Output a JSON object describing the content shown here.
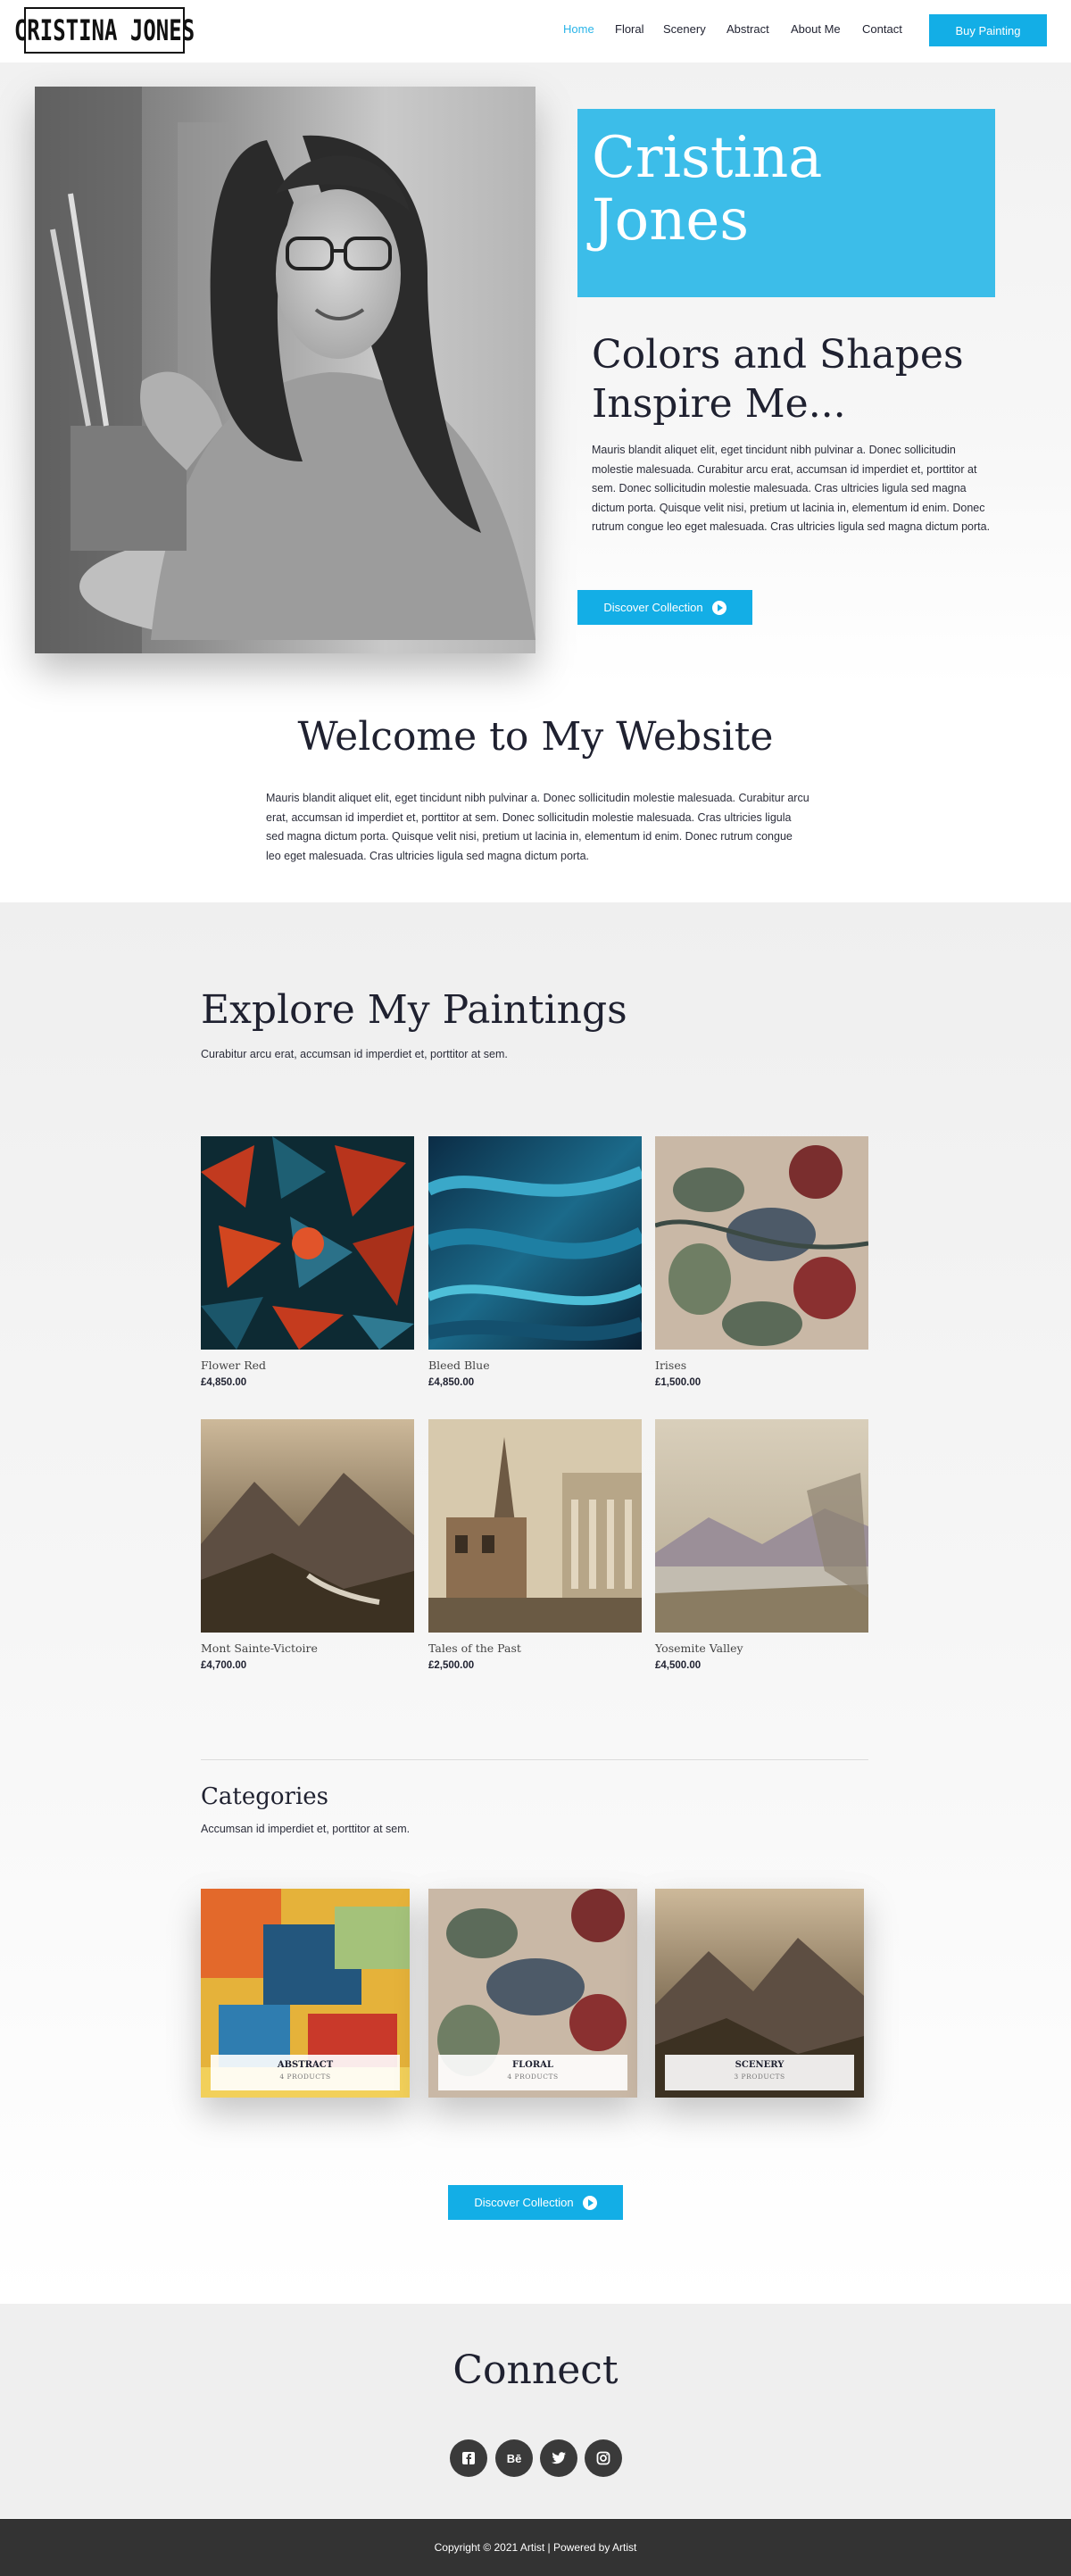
{
  "header": {
    "logo": "CRISTINA JONES",
    "nav": [
      {
        "label": "Home",
        "active": true
      },
      {
        "label": "Floral",
        "active": false
      },
      {
        "label": "Scenery",
        "active": false
      },
      {
        "label": "Abstract",
        "active": false
      },
      {
        "label": "About Me",
        "active": false
      },
      {
        "label": "Contact",
        "active": false
      }
    ],
    "cta": "Buy Painting"
  },
  "hero": {
    "name": "Cristina Jones",
    "heading": "Colors and Shapes Inspire Me...",
    "text": "Mauris blandit aliquet elit, eget tincidunt nibh pulvinar a. Donec sollicitudin molestie malesuada. Curabitur arcu erat, accumsan id imperdiet et, porttitor at sem. Donec sollicitudin molestie malesuada. Cras ultricies ligula sed magna dictum porta. Quisque velit nisi, pretium ut lacinia in, elementum id enim. Donec rutrum congue leo eget malesuada. Cras ultricies ligula sed magna dictum porta.",
    "button": "Discover Collection"
  },
  "welcome": {
    "title": "Welcome to My Website",
    "text": "Mauris blandit aliquet elit, eget tincidunt nibh pulvinar a. Donec sollicitudin molestie malesuada. Curabitur arcu erat, accumsan id imperdiet et, porttitor at sem. Donec sollicitudin molestie malesuada. Cras ultricies ligula sed magna dictum porta. Quisque velit nisi, pretium ut lacinia in, elementum id enim. Donec rutrum congue leo eget malesuada. Cras ultricies ligula sed magna dictum porta."
  },
  "explore": {
    "title": "Explore My Paintings",
    "subtitle": "Curabitur arcu erat, accumsan id imperdiet et, porttitor at sem.",
    "products": [
      {
        "name": "Flower Red",
        "price": "£4,850.00"
      },
      {
        "name": "Bleed Blue",
        "price": "£4,850.00"
      },
      {
        "name": "Irises",
        "price": "£1,500.00"
      },
      {
        "name": "Mont Sainte-Victoire",
        "price": "£4,700.00"
      },
      {
        "name": "Tales of the Past",
        "price": "£2,500.00"
      },
      {
        "name": "Yosemite Valley",
        "price": "£4,500.00"
      }
    ]
  },
  "categories": {
    "title": "Categories",
    "subtitle": "Accumsan id imperdiet et, porttitor at sem.",
    "items": [
      {
        "name": "ABSTRACT",
        "count": "4 PRODUCTS"
      },
      {
        "name": "FLORAL",
        "count": "4 PRODUCTS"
      },
      {
        "name": "SCENERY",
        "count": "3 PRODUCTS"
      }
    ],
    "button": "Discover Collection"
  },
  "connect": {
    "title": "Connect",
    "socials": [
      "facebook-icon",
      "behance-icon",
      "twitter-icon",
      "instagram-icon"
    ]
  },
  "footer": {
    "text": "Copyright © 2021 Artist | Powered by Artist"
  },
  "colors": {
    "accent": "#13aee6",
    "name_box": "#3cbde9",
    "dark_text": "#1f2130",
    "footer_bg": "#333333"
  }
}
